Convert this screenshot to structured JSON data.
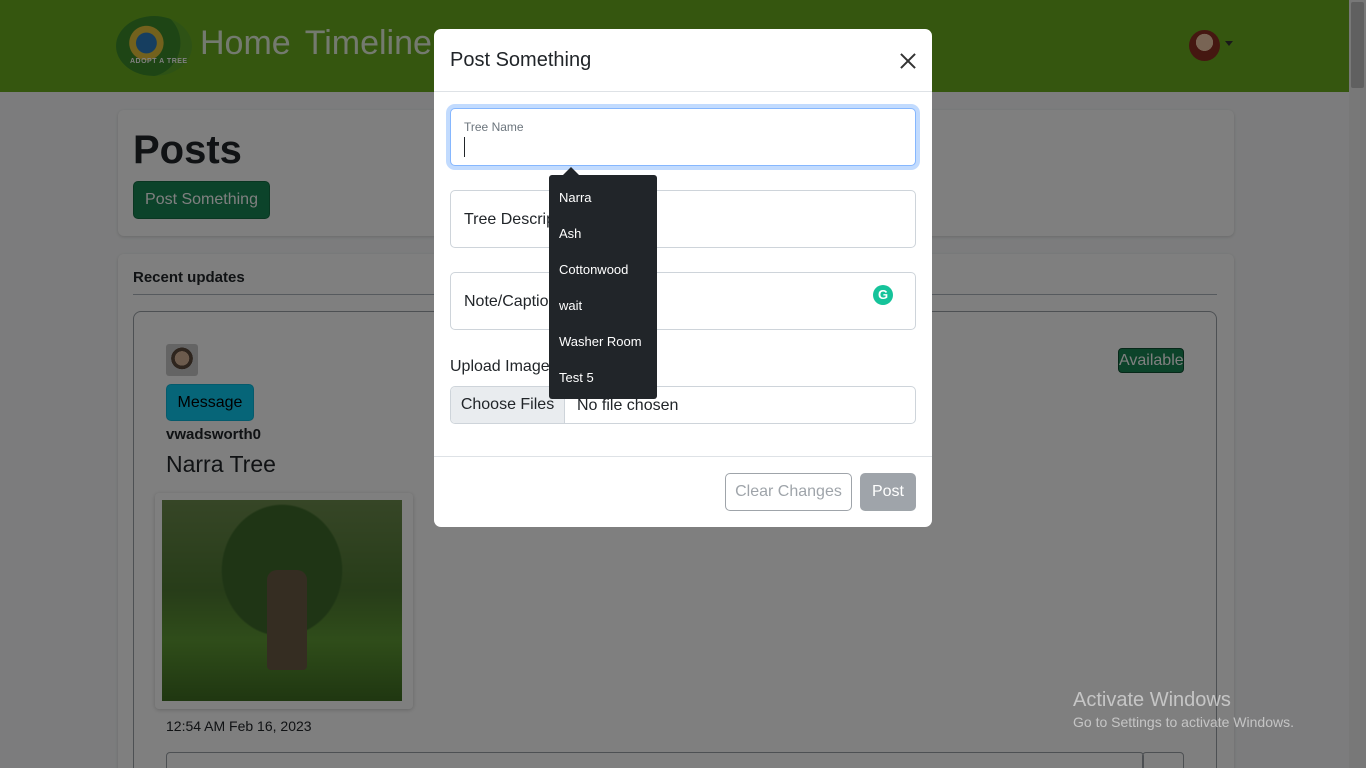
{
  "navbar": {
    "logo_text": "ADOPT A TREE",
    "links": [
      "Home",
      "Timeline"
    ]
  },
  "posts_section": {
    "title": "Posts",
    "post_button": "Post Something"
  },
  "updates_section": {
    "title": "Recent updates",
    "post": {
      "message_button": "Message",
      "username": "vwadsworth0",
      "tree_title": "Narra Tree",
      "status_badge": "Available",
      "timestamp": "12:54 AM Feb 16, 2023"
    }
  },
  "modal": {
    "title": "Post Something",
    "fields": {
      "tree_name_label": "Tree Name",
      "tree_name_value": "",
      "tree_description_label": "Tree Descrip",
      "note_caption_label": "Note/Captio"
    },
    "upload": {
      "label": "Upload Image",
      "choose_button": "Choose Files",
      "no_file_text": "No file chosen"
    },
    "footer": {
      "clear_button": "Clear Changes",
      "post_button": "Post"
    }
  },
  "suggestions": [
    "Narra",
    "Ash",
    "Cottonwood",
    "wait",
    "Washer Room",
    "Test 5"
  ],
  "grammarly_letter": "G",
  "windows_watermark": {
    "line1": "Activate Windows",
    "line2": "Go to Settings to activate Windows."
  },
  "colors": {
    "navbar": "#6aad1e",
    "success": "#198754",
    "info": "#0dcaf0",
    "tooltip": "#212529"
  }
}
